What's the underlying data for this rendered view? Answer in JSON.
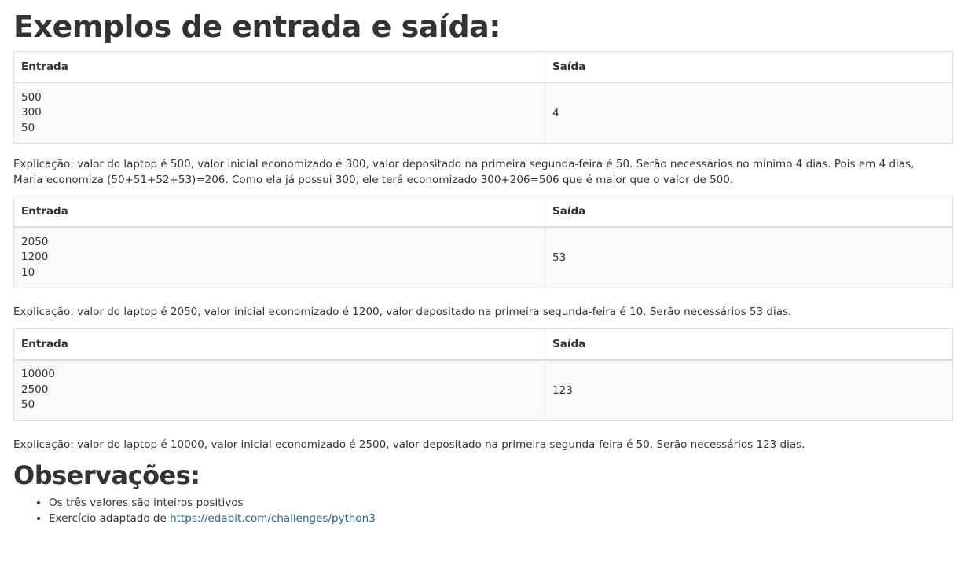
{
  "heading_examples": "Exemplos de entrada e saída:",
  "tables": [
    {
      "header_in": "Entrada",
      "header_out": "Saída",
      "inputs": [
        "500",
        "300",
        "50"
      ],
      "output": "4",
      "explanation": "Explicação: valor do laptop é 500, valor inicial economizado é 300, valor depositado na primeira segunda-feira é 50. Serão necessários no mínimo 4 dias. Pois em 4 dias, Maria economiza (50+51+52+53)=206. Como ela já possui 300, ele terá economizado 300+206=506 que é maior que o valor de 500."
    },
    {
      "header_in": "Entrada",
      "header_out": "Saída",
      "inputs": [
        "2050",
        "1200",
        "10"
      ],
      "output": "53",
      "explanation": "Explicação: valor do laptop é 2050, valor inicial economizado é 1200, valor depositado na primeira segunda-feira é 10. Serão necessários 53 dias."
    },
    {
      "header_in": "Entrada",
      "header_out": "Saída",
      "inputs": [
        "10000",
        "2500",
        "50"
      ],
      "output": "123",
      "explanation": "Explicação: valor do laptop é 10000, valor inicial economizado é 2500, valor depositado na primeira segunda-feira é 50. Serão necessários 123 dias."
    }
  ],
  "heading_notes": "Observações:",
  "notes": {
    "item1": "Os três valores são inteiros positivos",
    "item2_prefix": "Exercício adaptado de ",
    "item2_link": "https://edabit.com/challenges/python3"
  }
}
